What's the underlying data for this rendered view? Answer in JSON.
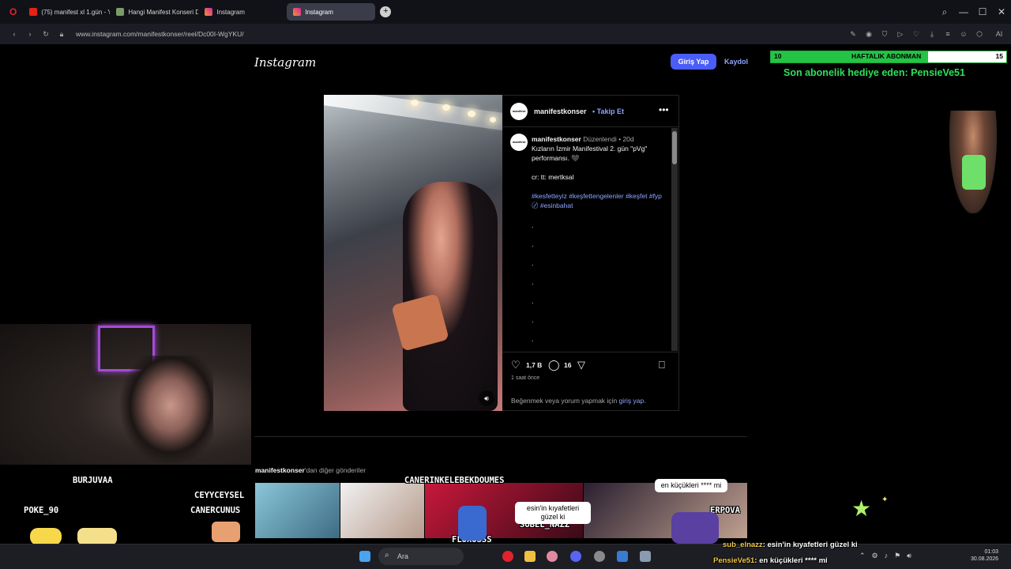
{
  "tabs": [
    {
      "label": "(75) manifest xl 1.gün - Yo",
      "color": "#e62117"
    },
    {
      "label": "Hangi Manifest Konseri D",
      "color": "#7a9c6b"
    },
    {
      "label": "Instagram",
      "color": "#d6249f"
    },
    {
      "label": "Instagram",
      "color": "#d6249f"
    }
  ],
  "address": {
    "url": "www.instagram.com/manifestkonser/reel/Dc00I-WgYKU/"
  },
  "instagram": {
    "logo": "Instagram",
    "login": "Giriş Yap",
    "signup": "Kaydol",
    "post": {
      "username": "manifestkonser",
      "follow": "• Takip Et",
      "avatar_text": "manifest",
      "caption_user": "manifestkonser",
      "caption_meta": "Düzenlendi • 20d",
      "caption_line1": "Kızların İzmir Manifestival 2. gün \"pVg\" performansı. 🖤",
      "caption_line2": "cr: tt: mertksal",
      "hashtags": "#kesfetteyiz #keşfettengelenler #keşfet #fyp〄 #esinbahat",
      "likes": "1,7 B",
      "comments": "16",
      "time": "1 saat önce",
      "like_prompt_prefix": "Beğenmek veya yorum yapmak için",
      "like_prompt_link": "giriş yap"
    },
    "more_posts_user": "manifestkonser",
    "more_posts_suffix": "'dan diğer gönderiler"
  },
  "stream": {
    "sub_goal_current": "10",
    "sub_goal_label": "HAFTALIK ABONMAN",
    "sub_goal_target": "15",
    "sub_goal_progress": 0.667,
    "gift_text": "Son abonelik hediye eden: PensieVe51",
    "names": [
      "BURJUVAA",
      "CEYYCEYSEL",
      "CANERINKELEBEKDOUMES",
      "POKE_90",
      "CANERCUNUS",
      "FLUXUSSS",
      "ERPOVA",
      "SUBEL_NAZZ"
    ],
    "bubble1": "en küçükleri **** mi",
    "bubble2": "esin'in kıyafetleri güzel ki",
    "chat1_user": "sub_elnazz",
    "chat1_msg": ": esin'in kıyafetleri güzel ki",
    "chat2_user": "PensieVe51",
    "chat2_msg": ": en küçükleri **** mi"
  },
  "taskbar": {
    "search": "Ara",
    "time": "01:03",
    "date": "30.08.2026"
  }
}
